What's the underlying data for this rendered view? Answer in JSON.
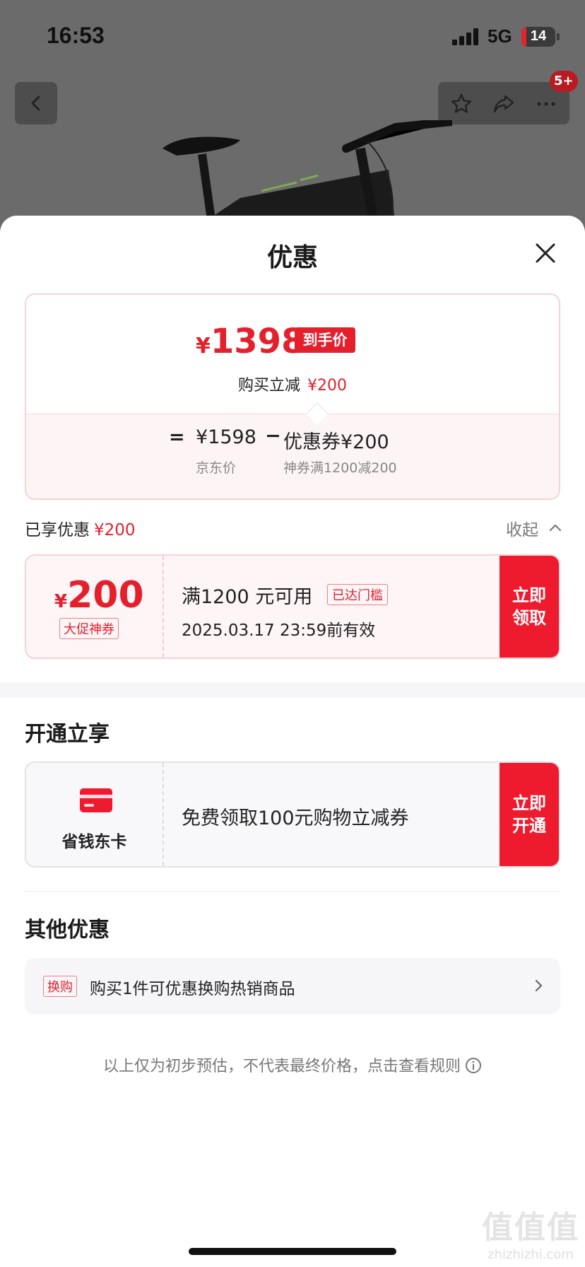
{
  "status_bar": {
    "time": "16:53",
    "network": "5G",
    "battery": "14"
  },
  "nav": {
    "badge": "5+"
  },
  "sheet": {
    "title": "优惠",
    "price_card": {
      "currency": "¥",
      "final_price": "1398",
      "final_tag": "到手价",
      "buy_reduce_label": "购买立减",
      "buy_reduce_value": "¥200",
      "equals": "=",
      "jd_price": "¥1598",
      "minus": "−",
      "coupon_label": "优惠券¥200",
      "jd_price_label": "京东价",
      "coupon_desc": "神券满1200减200"
    },
    "enjoyed": {
      "label": "已享优惠",
      "value": "¥200",
      "collapse": "收起"
    },
    "coupon": {
      "currency": "¥",
      "amount": "200",
      "type": "大促神券",
      "condition": "满1200 元可用",
      "tag": "已达门槛",
      "expiry": "2025.03.17 23:59前有效",
      "button": "立即领取"
    },
    "open_section": {
      "title": "开通立享",
      "member_name": "省钱东卡",
      "offer": "免费领取100元购物立减券",
      "button": "立即开通"
    },
    "other_section": {
      "title": "其他优惠",
      "tag": "换购",
      "text": "购买1件可优惠换购热销商品"
    },
    "disclaimer": "以上仅为初步预估，不代表最终价格，点击查看规则"
  },
  "watermark": {
    "big": "值值值",
    "small": "zhizhizhi.com"
  },
  "colors": {
    "accent": "#e4202d",
    "button": "#ee1b2e"
  },
  "icons": [
    "back-icon",
    "star-icon",
    "share-icon",
    "more-icon",
    "close-icon",
    "chevron-up-icon",
    "card-icon",
    "chevron-right-icon",
    "info-icon"
  ]
}
